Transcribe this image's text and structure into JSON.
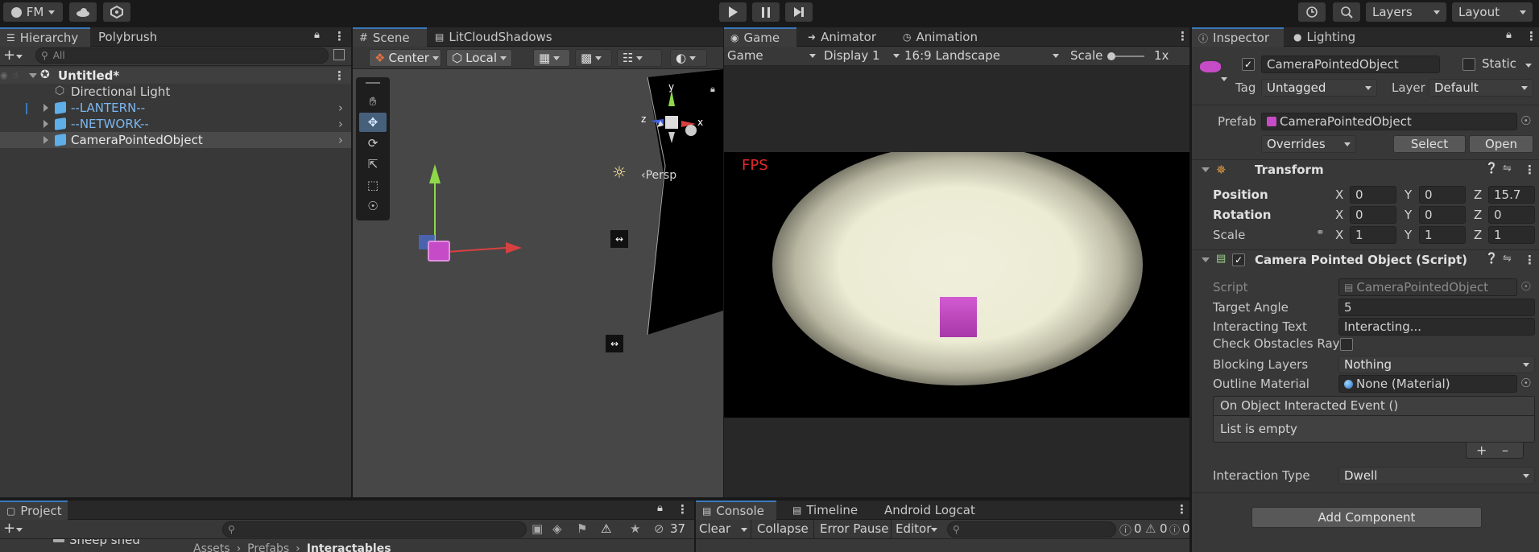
{
  "toolbar": {
    "account": "FM",
    "layers": "Layers",
    "layout": "Layout"
  },
  "hierarchy": {
    "tab": "Hierarchy",
    "tab2": "Polybrush",
    "search_placeholder": "All",
    "scene": "Untitled*",
    "items": [
      "Directional Light",
      "--LANTERN--",
      "--NETWORK--",
      "CameraPointedObject"
    ]
  },
  "scene": {
    "tab": "Scene",
    "tab2": "LitCloudShadows",
    "pivot": "Center",
    "space": "Local",
    "persp": "‹Persp"
  },
  "game": {
    "tab": "Game",
    "tab2": "Animator",
    "tab3": "Animation",
    "mode": "Game",
    "display": "Display 1",
    "aspect": "16:9 Landscape",
    "scale_label": "Scale",
    "scale_value": "1x",
    "fps": "FPS"
  },
  "inspector": {
    "tab": "Inspector",
    "tab2": "Lighting",
    "object_name": "CameraPointedObject",
    "static": "Static",
    "tag_label": "Tag",
    "tag": "Untagged",
    "layer_label": "Layer",
    "layer": "Default",
    "prefab_label": "Prefab",
    "prefab": "CameraPointedObject",
    "overrides": "Overrides",
    "select": "Select",
    "open": "Open",
    "transform": {
      "title": "Transform",
      "position": "Position",
      "rotation": "Rotation",
      "scale": "Scale",
      "pos": [
        "0",
        "0",
        "15.7"
      ],
      "rot": [
        "0",
        "0",
        "0"
      ],
      "scl": [
        "1",
        "1",
        "1"
      ],
      "axes": [
        "X",
        "Y",
        "Z"
      ]
    },
    "script_component": {
      "title": "Camera Pointed Object (Script)",
      "script_label": "Script",
      "script": "CameraPointedObject",
      "target_angle_label": "Target Angle",
      "target_angle": "5",
      "interacting_text_label": "Interacting Text",
      "interacting_text": "Interacting...",
      "check_obstacles_label": "Check Obstacles Ray",
      "blocking_layers_label": "Blocking Layers",
      "blocking_layers": "Nothing",
      "outline_material_label": "Outline Material",
      "outline_material": "None (Material)",
      "event_title": "On Object Interacted Event ()",
      "list_empty": "List is empty",
      "plus": "+",
      "minus": "–",
      "interaction_type_label": "Interaction Type",
      "interaction_type": "Dwell"
    },
    "add_component": "Add Component"
  },
  "project": {
    "tab": "Project",
    "folder": "Sheep shed",
    "path": [
      "Assets",
      "Prefabs",
      "Interactables"
    ],
    "count": "37"
  },
  "console": {
    "tab": "Console",
    "tab2": "Timeline",
    "tab3": "Android Logcat",
    "clear": "Clear",
    "collapse": "Collapse",
    "error_pause": "Error Pause",
    "editor": "Editor",
    "info_count": "0",
    "warn_count": "0",
    "error_count": "0"
  },
  "colors": {
    "accent": "#3a79bb",
    "fps": "#e02a2a",
    "cube": "#c64bc6",
    "highlight": "#4a4a4a"
  }
}
